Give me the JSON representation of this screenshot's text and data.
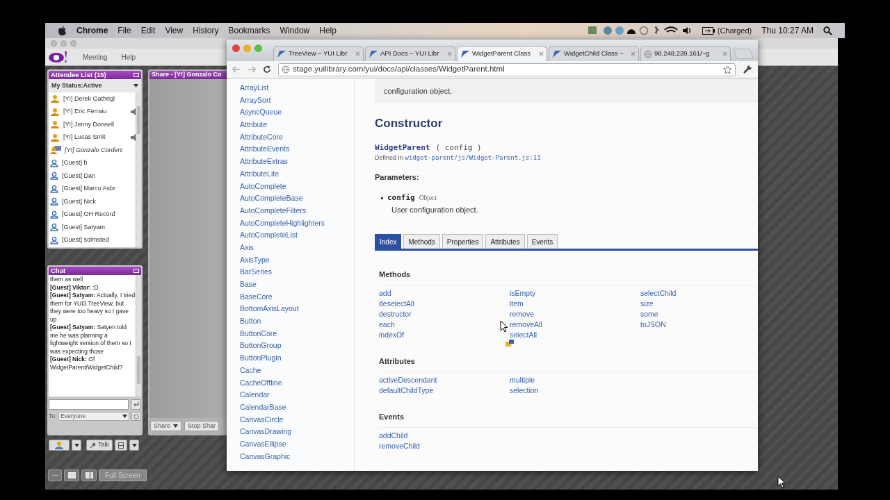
{
  "menubar": {
    "app": "Chrome",
    "menus": [
      "File",
      "Edit",
      "View",
      "History",
      "Bookmarks",
      "Window",
      "Help"
    ],
    "battery": "(Charged)",
    "clock": "Thu 10:27 AM"
  },
  "meeting": {
    "menu": [
      "Meeting",
      "Help"
    ],
    "attendees": {
      "title": "Attendee List (15)",
      "status": "My Status:Active",
      "items": [
        {
          "name": "[Y!] Derek Gathrigl",
          "kind": "yahoo",
          "speaking": false
        },
        {
          "name": "[Y!] Eric Ferraiu",
          "kind": "yahoo",
          "speaking": true
        },
        {
          "name": "[Y!] Jenny Donnell",
          "kind": "yahoo",
          "speaking": false
        },
        {
          "name": "[Y!] Lucas Smit",
          "kind": "yahoo",
          "speaking": true
        },
        {
          "name": "[Y!] Gonzalo Corderc",
          "kind": "presenter",
          "speaking": false
        },
        {
          "name": "[Guest] b",
          "kind": "guest",
          "speaking": false
        },
        {
          "name": "[Guest] Dan",
          "kind": "guest",
          "speaking": false
        },
        {
          "name": "[Guest] Marco Asbr",
          "kind": "guest",
          "speaking": false
        },
        {
          "name": "[Guest] Nick",
          "kind": "guest",
          "speaking": false
        },
        {
          "name": "[Guest] OH Record",
          "kind": "guest",
          "speaking": false
        },
        {
          "name": "[Guest] Satyam",
          "kind": "guest",
          "speaking": false
        },
        {
          "name": "[Guest] solmsted",
          "kind": "guest",
          "speaking": false
        }
      ]
    },
    "chat": {
      "title": "Chat",
      "messages": [
        "them as well",
        "**[Guest] Viktor:** :D",
        "**[Guest] Satyam:** Actually, I tried them for YUI3 TreeView, but they were too heavy so I gave up",
        "**[Guest] Satyam:** Satyen told me he was planning a lightweight version of them so I was expecting those",
        "**[Guest] Nick:** Of WidgetParent/WidgetChild?"
      ],
      "to_label": "To:",
      "recipient": "Everyone"
    },
    "share": {
      "title": "Share - [Y!] Gonzalo Co",
      "share_button": "Share",
      "stop_button": "Stop Shar"
    },
    "talk_button": "Talk",
    "full_screen_button": "Full Screen"
  },
  "browser": {
    "tabs": [
      {
        "label": "TreeView – YUI Libr",
        "kind": "yui",
        "selected": false
      },
      {
        "label": "API Docs – YUI Libr",
        "kind": "yui",
        "selected": false
      },
      {
        "label": "WidgetParent Class",
        "kind": "yui",
        "selected": true
      },
      {
        "label": "WidgetChild Class –",
        "kind": "yui",
        "selected": false
      },
      {
        "label": "98.248.239.161/~g",
        "kind": "web",
        "selected": false
      }
    ],
    "url": "stage.yuilibrary.com/yui/docs/api/classes/WidgetParent.html",
    "classes": [
      "ArrayList",
      "ArraySort",
      "AsyncQueue",
      "Attribute",
      "AttributeCore",
      "AttributeEvents",
      "AttributeExtras",
      "AttributeLite",
      "AutoComplete",
      "AutoCompleteBase",
      "AutoCompleteFilters",
      "AutoCompleteHighlighters",
      "AutoCompleteList",
      "Axis",
      "AxisType",
      "BarSeries",
      "Base",
      "BaseCore",
      "BottomAxisLayout",
      "Button",
      "ButtonCore",
      "ButtonGroup",
      "ButtonPlugin",
      "Cache",
      "CacheOffline",
      "Calendar",
      "CalendarBase",
      "CanvasCircle",
      "CanvasDrawing",
      "CanvasEllipse",
      "CanvasGraphic"
    ],
    "doc": {
      "intro": "configuration object.",
      "heading": "Constructor",
      "signature_name": "WidgetParent",
      "signature_args": "( config )",
      "defined_in": "Defined in",
      "source_link": "widget-parent/js/Widget-Parent.js:11",
      "params_heading": "Parameters:",
      "param_name": "config",
      "param_type": "Object",
      "param_desc": "User configuration object.",
      "tabs": [
        {
          "label": "Index",
          "selected": true
        },
        {
          "label": "Methods",
          "selected": false
        },
        {
          "label": "Properties",
          "selected": false
        },
        {
          "label": "Attributes",
          "selected": false
        },
        {
          "label": "Events",
          "selected": false
        }
      ],
      "sections": [
        {
          "title": "Methods",
          "columns": [
            [
              "add",
              "deselectAll",
              "destructor",
              "each",
              "indexOf"
            ],
            [
              "isEmpty",
              "item",
              "remove",
              "removeAll",
              "selectAll"
            ],
            [
              "selectChild",
              "size",
              "some",
              "toJSON"
            ]
          ]
        },
        {
          "title": "Attributes",
          "columns": [
            [
              "activeDescendant",
              "defaultChildType"
            ],
            [
              "multiple",
              "selection"
            ]
          ]
        },
        {
          "title": "Events",
          "columns": [
            [
              "addChild",
              "removeChild"
            ]
          ]
        }
      ]
    }
  }
}
